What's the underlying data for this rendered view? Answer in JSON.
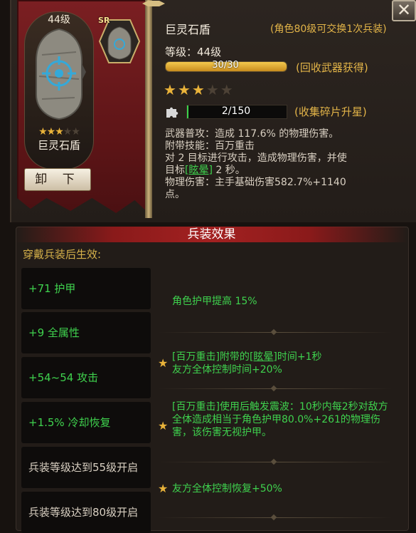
{
  "item": {
    "card_level": "44级",
    "name": "巨灵石盾",
    "card_stars_filled": 3,
    "stars_total": 5,
    "unequip_label": "卸 下",
    "rarity_badge": "SR"
  },
  "header": {
    "title": "巨灵石盾",
    "exchange_note": "(角色80级可交换1次兵装)",
    "level_label": "等级：44级",
    "xp_text": "30/30",
    "xp_fraction": 1.0,
    "xp_note": "(回收武器获得)",
    "stars_filled": 3,
    "fragments_text": "2/150",
    "fragments_fraction": 0.013,
    "fragments_note": "(收集碎片升星)"
  },
  "description": {
    "line1": "武器普攻：造成 117.6% 的物理伤害。",
    "line2": "附带技能：百万重击",
    "line3": "对 2 目标进行攻击，造成物理伤害，并使",
    "line4_prefix": "目标",
    "line4_link": "[眩晕]",
    "line4_suffix": " 2 秒。",
    "line5": "物理伤害：主手基础伤害582.7%+1140",
    "line6": "点。"
  },
  "effects_section": {
    "header": "兵装效果",
    "subtitle": "穿戴兵装后生效:",
    "stats": [
      {
        "text": "+71 护甲"
      },
      {
        "text": "+9 全属性"
      },
      {
        "text": "+54~54 攻击"
      },
      {
        "text": "+1.5% 冷却恢复"
      },
      {
        "text": "兵装等级达到55级开启"
      },
      {
        "text": "兵装等级达到80级开启"
      }
    ],
    "effect1": "角色护甲提高 15%",
    "effect2_a": "[百万重击]附带的",
    "effect2_link": "[眩晕]",
    "effect2_b": "时间+1秒",
    "effect2_c": "友方全体控制时间+20%",
    "effect3": "[百万重击]使用后触发震波：10秒内每2秒对敌方全体造成相当于角色护甲80.0%+261的物理伤害，该伤害无视护甲。",
    "effect4": "友方全体控制恢复+50%"
  },
  "colors": {
    "accent_gold": "#e2b448",
    "effect_green": "#3fd24e",
    "banner_red": "#7b1f22"
  },
  "icons": {
    "close": "close-icon",
    "star": "star-icon",
    "puzzle": "puzzle-icon"
  }
}
